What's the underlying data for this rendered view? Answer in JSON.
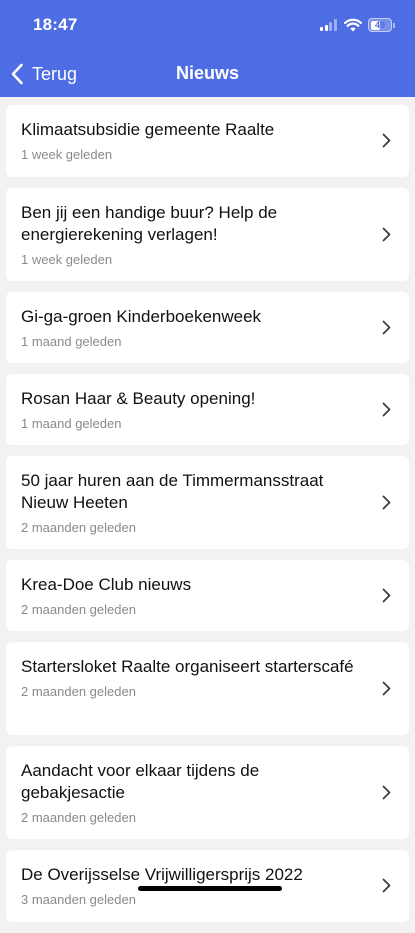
{
  "status_bar": {
    "time": "18:47",
    "battery": "49",
    "battery_level": 0.49
  },
  "header": {
    "back_label": "Terug",
    "title": "Nieuws",
    "background": "#4e6ce3"
  },
  "news": [
    {
      "title": "Klimaatsubsidie gemeente Raalte",
      "date": "1 week geleden"
    },
    {
      "title": "Ben jij een handige buur? Help de energierekening verlagen!",
      "date": "1 week geleden"
    },
    {
      "title": "Gi-ga-groen Kinderboekenweek",
      "date": "1 maand geleden"
    },
    {
      "title": "Rosan Haar & Beauty opening!",
      "date": "1 maand geleden"
    },
    {
      "title": "50 jaar huren aan de Timmermansstraat Nieuw Heeten",
      "date": "2 maanden geleden"
    },
    {
      "title": "Krea-Doe Club nieuws",
      "date": "2 maanden geleden"
    },
    {
      "title": "Startersloket Raalte organiseert starterscafé",
      "date": "2 maanden geleden"
    },
    {
      "title": "Aandacht voor elkaar tijdens de gebakjesactie",
      "date": "2 maanden geleden"
    },
    {
      "title": "De Overijsselse Vrijwilligersprijs 2022",
      "date": "3 maanden geleden"
    }
  ],
  "icons": {
    "back": "chevron-left-icon",
    "row": "chevron-right-icon",
    "signal": "cellular-signal-icon",
    "wifi": "wifi-icon",
    "battery": "battery-icon"
  }
}
